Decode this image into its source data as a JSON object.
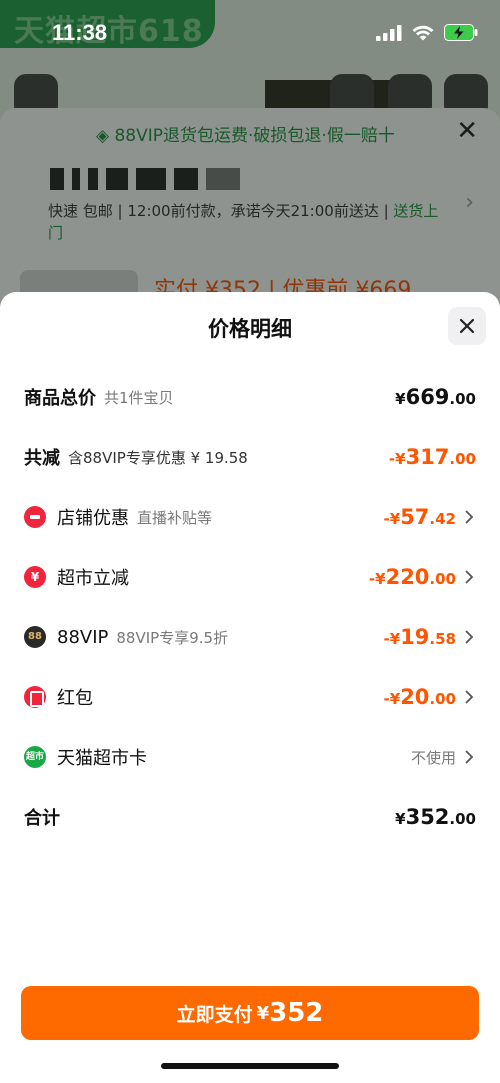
{
  "status_bar": {
    "time": "11:38"
  },
  "background": {
    "brand_text": "天猫超市618",
    "banner": "88VIP退货包运费·破损包退·假一赔十",
    "delivery_prefix": "快速 包邮 | 12:00前付款，承诺今天21:00前送达 |",
    "delivery_highlight": "送货上门",
    "price_text": "实付 ¥352 | 优惠前 ¥669"
  },
  "modal": {
    "title": "价格明细",
    "rows": [
      {
        "label": "商品总价",
        "sub": "共1件宝贝",
        "prefix": "¥",
        "amount": "669",
        "decimal": ".00"
      },
      {
        "label": "共减",
        "sub": "含88VIP专享优惠 ¥ 19.58",
        "prefix": "-¥",
        "amount": "317",
        "decimal": ".00"
      },
      {
        "label": "店铺优惠",
        "sub": "直播补贴等",
        "prefix": "-¥",
        "amount": "57",
        "decimal": ".42"
      },
      {
        "label": "超市立减",
        "sub": "",
        "prefix": "-¥",
        "amount": "220",
        "decimal": ".00"
      },
      {
        "label": "88VIP",
        "sub": "88VIP专享9.5折",
        "prefix": "-¥",
        "amount": "19",
        "decimal": ".58"
      },
      {
        "label": "红包",
        "sub": "",
        "prefix": "-¥",
        "amount": "20",
        "decimal": ".00"
      },
      {
        "label": "天猫超市卡",
        "sub": "",
        "value_text": "不使用"
      },
      {
        "label": "合计",
        "sub": "",
        "prefix": "¥",
        "amount": "352",
        "decimal": ".00"
      }
    ],
    "icons": {
      "88vip_badge": "88",
      "card_badge": "超市"
    }
  },
  "pay_button": {
    "label": "立即支付",
    "currency": "¥",
    "amount": "352"
  },
  "colors": {
    "accent": "#ff6a00",
    "discount": "#ff5500",
    "brand_green": "#1f9e4a"
  }
}
